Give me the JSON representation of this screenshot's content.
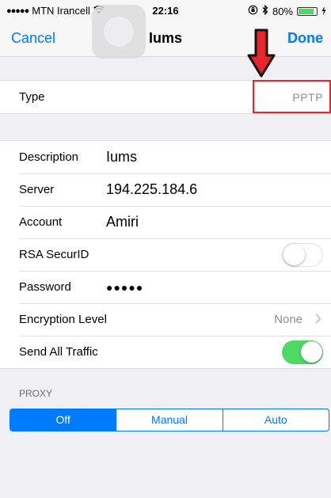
{
  "status_bar": {
    "signal": "●●●●●",
    "carrier": "MTN Irancell",
    "time": "22:16",
    "battery": "80%"
  },
  "nav": {
    "cancel": "Cancel",
    "title": "Iums",
    "done": "Done"
  },
  "type_row": {
    "label": "Type",
    "value": "PPTP"
  },
  "fields": {
    "description": {
      "label": "Description",
      "value": "Iums"
    },
    "server": {
      "label": "Server",
      "value": "194.225.184.6"
    },
    "account": {
      "label": "Account",
      "value": "Amiri"
    },
    "rsa": {
      "label": "RSA SecurID",
      "on": false
    },
    "password": {
      "label": "Password",
      "value": "●●●●●"
    },
    "encryption": {
      "label": "Encryption Level",
      "value": "None"
    },
    "send_all": {
      "label": "Send All Traffic",
      "on": true
    }
  },
  "proxy": {
    "header": "PROXY",
    "options": [
      "Off",
      "Manual",
      "Auto"
    ],
    "selected": "Off"
  },
  "colors": {
    "accent": "#007aff",
    "toggle_on": "#4cd964",
    "annotation": "#e8252b"
  }
}
